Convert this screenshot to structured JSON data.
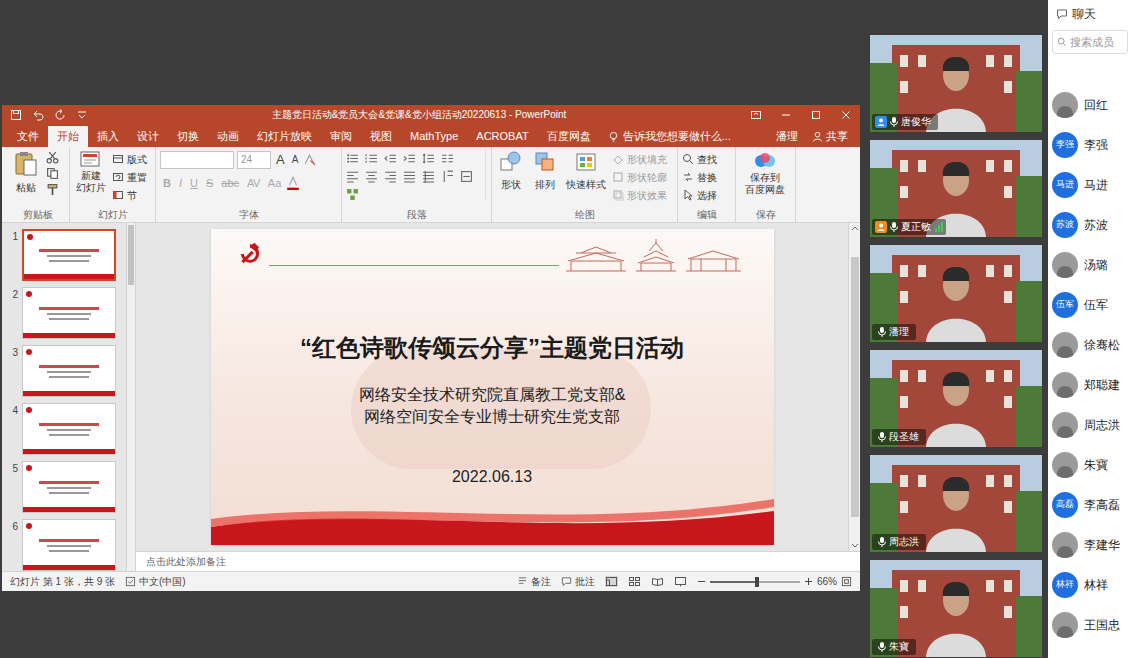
{
  "ppt": {
    "title": "主题党日活动&党员大会&党课&党小组活动20220613 - PowerPoint",
    "tabs": [
      {
        "label": "文件",
        "selected": false
      },
      {
        "label": "开始",
        "selected": true
      },
      {
        "label": "插入",
        "selected": false
      },
      {
        "label": "设计",
        "selected": false
      },
      {
        "label": "切换",
        "selected": false
      },
      {
        "label": "动画",
        "selected": false
      },
      {
        "label": "幻灯片放映",
        "selected": false
      },
      {
        "label": "审阅",
        "selected": false
      },
      {
        "label": "视图",
        "selected": false
      },
      {
        "label": "MathType",
        "selected": false
      },
      {
        "label": "ACROBAT",
        "selected": false
      },
      {
        "label": "百度网盘",
        "selected": false
      }
    ],
    "tell_me": "告诉我您想要做什么...",
    "user": "潘理",
    "share": "共享",
    "ribbon": {
      "groups": [
        "剪贴板",
        "幻灯片",
        "字体",
        "段落",
        "绘图",
        "编辑",
        "保存"
      ],
      "paste": "粘贴",
      "new_slide": [
        "新建",
        "幻灯片"
      ],
      "slide_items": [
        "版式",
        "重置",
        "节"
      ],
      "font_size": "24",
      "font_size_buttons": [
        "A",
        "A"
      ],
      "font_buttons": [
        "B",
        "I",
        "U",
        "S",
        "abc",
        "AV",
        "Aa"
      ],
      "shapes": "形状",
      "arrange": "排列",
      "quick_styles": "快速样式",
      "shape_format": [
        "形状填充",
        "形状轮廓",
        "形状效果"
      ],
      "editing": [
        "查找",
        "替换",
        "选择"
      ],
      "save": [
        "保存到",
        "百度网盘"
      ]
    },
    "thumbnails": [
      {
        "number": "1",
        "selected": true
      },
      {
        "number": "2",
        "selected": false
      },
      {
        "number": "3",
        "selected": false
      },
      {
        "number": "4",
        "selected": false
      },
      {
        "number": "5",
        "selected": false
      },
      {
        "number": "6",
        "selected": false
      }
    ],
    "slide": {
      "title": "“红色诗歌传颂云分享”主题党日活动",
      "lines": [
        "网络安全技术研究院直属教工党支部&",
        "网络空间安全专业博士研究生党支部"
      ],
      "date": "2022.06.13"
    },
    "notes_placeholder": "点击此处添加备注",
    "status": {
      "slide_info": "幻灯片 第 1 张，共 9 张",
      "language": "中文(中国)",
      "notes": "备注",
      "comments": "批注",
      "zoom": "66%",
      "zoom_level": 0.5
    }
  },
  "videos": [
    {
      "name": "唐俊华",
      "badge": "host",
      "signal": false
    },
    {
      "name": "夏正敏",
      "badge": "cohost",
      "signal": true
    },
    {
      "name": "潘理",
      "badge": "none",
      "signal": false
    },
    {
      "name": "段圣雄",
      "badge": "none",
      "signal": false
    },
    {
      "name": "周志洪",
      "badge": "none",
      "signal": false
    },
    {
      "name": "朱寶",
      "badge": "none",
      "signal": false
    }
  ],
  "chat": {
    "title": "聊天",
    "search": {
      "placeholder": "搜索成员"
    },
    "members": [
      {
        "name": "回红",
        "kind": "photo",
        "avatar": ""
      },
      {
        "name": "李强",
        "kind": "text",
        "avatar": "李强"
      },
      {
        "name": "马进",
        "kind": "text",
        "avatar": "马进"
      },
      {
        "name": "苏波",
        "kind": "text",
        "avatar": "苏波"
      },
      {
        "name": "汤璐",
        "kind": "photo",
        "avatar": ""
      },
      {
        "name": "伍军",
        "kind": "text",
        "avatar": "伍军"
      },
      {
        "name": "徐骞松",
        "kind": "photo",
        "avatar": ""
      },
      {
        "name": "郑聪建",
        "kind": "photo",
        "avatar": ""
      },
      {
        "name": "周志洪",
        "kind": "photo",
        "avatar": ""
      },
      {
        "name": "朱寶",
        "kind": "photo",
        "avatar": ""
      },
      {
        "name": "李高磊",
        "kind": "text",
        "avatar": "高磊"
      },
      {
        "name": "李建华",
        "kind": "photo",
        "avatar": ""
      },
      {
        "name": "林祥",
        "kind": "text",
        "avatar": "林祥"
      },
      {
        "name": "王国忠",
        "kind": "photo",
        "avatar": ""
      }
    ]
  }
}
